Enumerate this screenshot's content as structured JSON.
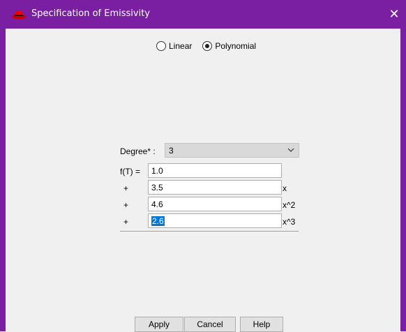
{
  "window": {
    "title": "Specification of Emissivity",
    "close_glyph": "✕",
    "accent_color": "#7b1fa2"
  },
  "mode": {
    "options": [
      {
        "label": "Linear",
        "checked": false
      },
      {
        "label": "Polynomial",
        "checked": true
      }
    ]
  },
  "degree": {
    "label": "Degree* :",
    "value": "3"
  },
  "function": {
    "label": "f(T) =",
    "terms": [
      {
        "operator": "",
        "value": "1.0",
        "suffix": ""
      },
      {
        "operator": "+",
        "value": "3.5",
        "suffix": "x"
      },
      {
        "operator": "+",
        "value": "4.6",
        "suffix": "x^2"
      },
      {
        "operator": "+",
        "value": "2.6",
        "suffix": "x^3"
      }
    ]
  },
  "buttons": {
    "apply": "Apply",
    "cancel": "Cancel",
    "help": "Help"
  }
}
